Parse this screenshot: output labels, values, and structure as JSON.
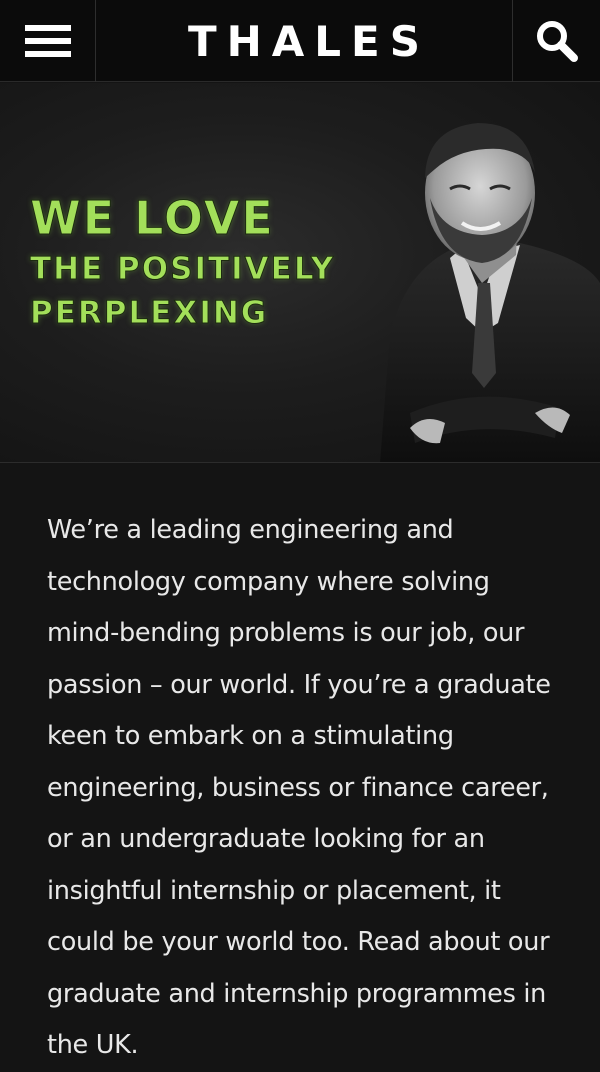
{
  "header": {
    "brand": "THALES",
    "menu_icon": "hamburger-menu-icon",
    "search_icon": "search-icon"
  },
  "hero": {
    "slogan_line1": "WE LOVE",
    "slogan_line2": "THE POSITIVELY",
    "slogan_line3": "PERPLEXING",
    "accent_color": "#a3df5a"
  },
  "content": {
    "paragraph": "We’re a leading engineering and technology company where solving mind-bending problems is our job, our passion – our world. If you’re a graduate keen to embark on a stimulating engineering, business or finance career, or an undergraduate looking for an insightful internship or placement, it could be your world too. Read about our graduate and internship programmes in the UK."
  }
}
